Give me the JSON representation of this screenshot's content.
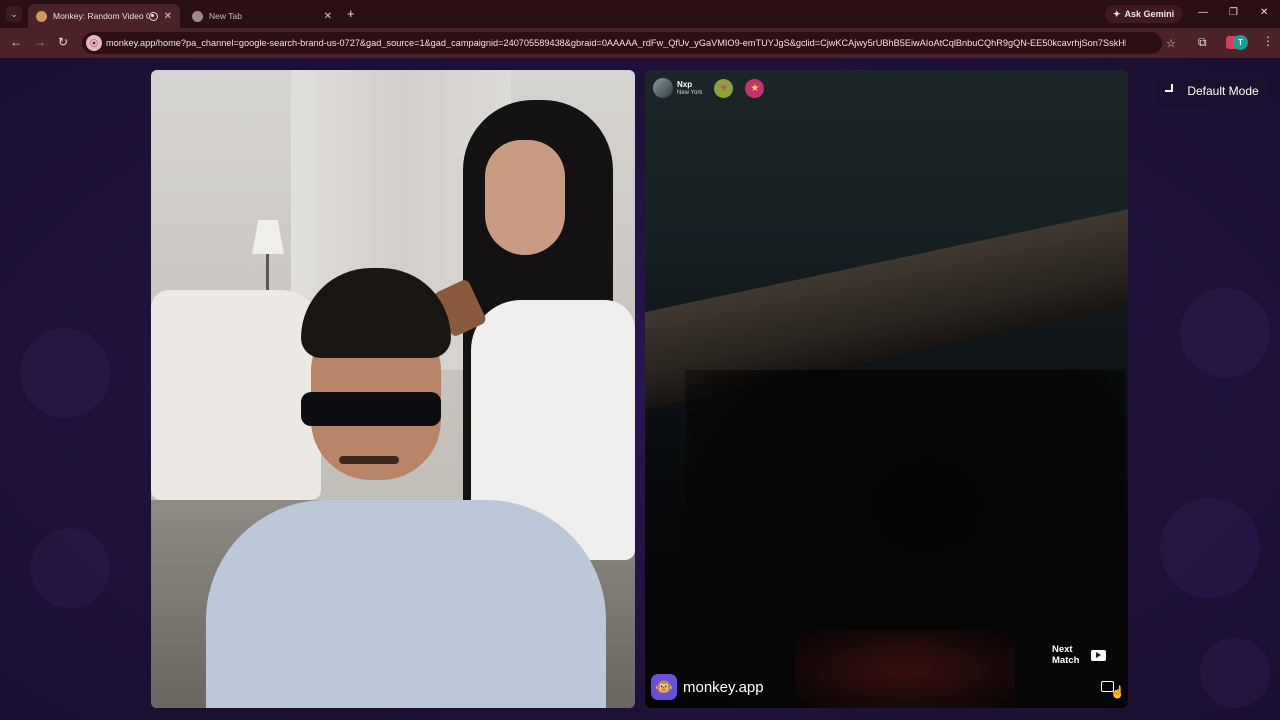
{
  "browser": {
    "tabs": [
      {
        "title": "Monkey: Random Video Ch",
        "active": true
      },
      {
        "title": "New Tab",
        "active": false
      }
    ],
    "new_tab_symbol": "+",
    "ask_gemini_label": "Ask Gemini",
    "url": "monkey.app/home?pa_channel=google-search-brand-us-0727&gad_source=1&gad_campaignid=240705589438&gbraid=0AAAAA_rdFw_QfUv_yGaVMIO9-emTUYJgS&gclid=CjwKCAjwy5rUBhB5EiwAIoAtCqlBnbuCQhR9gQN-EE50kcavrhjSon7SskHRn...",
    "profile_initial": "T",
    "icons": [
      "chevron-down-icon",
      "close-icon",
      "back-icon",
      "forward-icon",
      "reload-icon",
      "star-icon",
      "extensions-icon",
      "menu-icon",
      "minimize-icon",
      "maximize-icon"
    ]
  },
  "app": {
    "mode_button_label": "Default Mode",
    "remote_user": {
      "name": "Nxp",
      "location": "New York"
    },
    "next_match_label_line1": "Next",
    "next_match_label_line2": "Match",
    "brand_text": "monkey.app"
  },
  "colors": {
    "page_bg": "#1f1238",
    "tab_strip": "#2a0f14",
    "toolbar": "#4a2227",
    "brand_purple": "#6b4fd8"
  }
}
